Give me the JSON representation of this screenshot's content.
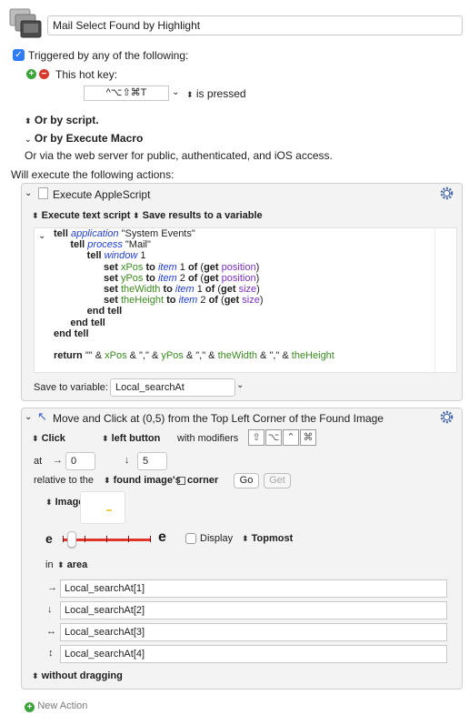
{
  "macro": {
    "name": "Mail Select Found by Highlight"
  },
  "triggers": {
    "heading": "Triggered by any of the following:",
    "hotkey_label": "This hot key:",
    "hotkey_value": "^⌥⇧⌘T",
    "hotkey_state": "is pressed",
    "or_script": "Or by script.",
    "or_execute_macro": "Or by Execute Macro",
    "web_server": "Or via the web server for public, authenticated, and iOS access."
  },
  "will_execute": "Will execute the following actions:",
  "action1": {
    "title": "Execute AppleScript",
    "mode": "Execute text script",
    "results_mode": "Save results to a variable",
    "code_lines": [
      [
        {
          "t": "tell ",
          "c": "kw"
        },
        {
          "t": "application",
          "c": "cls"
        },
        {
          "t": " \"System Events\"",
          "c": ""
        }
      ],
      [
        {
          "t": "      tell ",
          "c": "kw"
        },
        {
          "t": "process",
          "c": "cls"
        },
        {
          "t": " \"Mail\"",
          "c": ""
        }
      ],
      [
        {
          "t": "            tell ",
          "c": "kw"
        },
        {
          "t": "window",
          "c": "cls"
        },
        {
          "t": " 1",
          "c": ""
        }
      ],
      [
        {
          "t": "                  set ",
          "c": "kw"
        },
        {
          "t": "xPos",
          "c": "var"
        },
        {
          "t": " to ",
          "c": "kw"
        },
        {
          "t": "item",
          "c": "cls"
        },
        {
          "t": " 1 ",
          "c": ""
        },
        {
          "t": "of",
          "c": "kw"
        },
        {
          "t": " (",
          "c": ""
        },
        {
          "t": "get",
          "c": "kw"
        },
        {
          "t": " ",
          "c": ""
        },
        {
          "t": "position",
          "c": "prop"
        },
        {
          "t": ")",
          "c": ""
        }
      ],
      [
        {
          "t": "                  set ",
          "c": "kw"
        },
        {
          "t": "yPos",
          "c": "var"
        },
        {
          "t": " to ",
          "c": "kw"
        },
        {
          "t": "item",
          "c": "cls"
        },
        {
          "t": " 2 ",
          "c": ""
        },
        {
          "t": "of",
          "c": "kw"
        },
        {
          "t": " (",
          "c": ""
        },
        {
          "t": "get",
          "c": "kw"
        },
        {
          "t": " ",
          "c": ""
        },
        {
          "t": "position",
          "c": "prop"
        },
        {
          "t": ")",
          "c": ""
        }
      ],
      [
        {
          "t": "                  set ",
          "c": "kw"
        },
        {
          "t": "theWidth",
          "c": "var"
        },
        {
          "t": " to ",
          "c": "kw"
        },
        {
          "t": "item",
          "c": "cls"
        },
        {
          "t": " 1 ",
          "c": ""
        },
        {
          "t": "of",
          "c": "kw"
        },
        {
          "t": " (",
          "c": ""
        },
        {
          "t": "get",
          "c": "kw"
        },
        {
          "t": " ",
          "c": ""
        },
        {
          "t": "size",
          "c": "prop"
        },
        {
          "t": ")",
          "c": ""
        }
      ],
      [
        {
          "t": "                  set ",
          "c": "kw"
        },
        {
          "t": "theHeight",
          "c": "var"
        },
        {
          "t": " to ",
          "c": "kw"
        },
        {
          "t": "item",
          "c": "cls"
        },
        {
          "t": " 2 ",
          "c": ""
        },
        {
          "t": "of",
          "c": "kw"
        },
        {
          "t": " (",
          "c": ""
        },
        {
          "t": "get",
          "c": "kw"
        },
        {
          "t": " ",
          "c": ""
        },
        {
          "t": "size",
          "c": "prop"
        },
        {
          "t": ")",
          "c": ""
        }
      ],
      [
        {
          "t": "            end tell",
          "c": "kw"
        }
      ],
      [
        {
          "t": "      end tell",
          "c": "kw"
        }
      ],
      [
        {
          "t": "end tell",
          "c": "kw"
        }
      ],
      [
        {
          "t": "",
          "c": ""
        }
      ],
      [
        {
          "t": "return",
          "c": "kw"
        },
        {
          "t": " \"\" & ",
          "c": ""
        },
        {
          "t": "xPos",
          "c": "var"
        },
        {
          "t": " & \",\" & ",
          "c": ""
        },
        {
          "t": "yPos",
          "c": "var"
        },
        {
          "t": " & \",\" & ",
          "c": ""
        },
        {
          "t": "theWidth",
          "c": "var"
        },
        {
          "t": " & \",\" & ",
          "c": ""
        },
        {
          "t": "theHeight",
          "c": "var"
        }
      ]
    ],
    "save_label": "Save to variable:",
    "save_variable": "Local_searchAt"
  },
  "action2": {
    "title": "Move and Click at (0,5) from the Top Left Corner of the Found Image",
    "click_mode": "Click",
    "button": "left button",
    "modifiers_label": "with modifiers",
    "modifier_symbols": [
      "⇧",
      "⌥",
      "⌃",
      "⌘"
    ],
    "at_label": "at",
    "x_value": "0",
    "y_value": "5",
    "relative_label": "relative to the",
    "relative_option": "found image's",
    "corner_label": "corner",
    "go_button": "Go",
    "get_button": "Get",
    "image_label": "Image:",
    "display_label": "Display",
    "topmost_label": "Topmost",
    "in_label": "in",
    "area_option": "area",
    "area_fields": [
      "Local_searchAt[1]",
      "Local_searchAt[2]",
      "Local_searchAt[3]",
      "Local_searchAt[4]"
    ],
    "area_icons": [
      "→",
      "↓",
      "↔",
      "↕"
    ],
    "dragging_option": "without dragging"
  },
  "new_action": "New Action",
  "colors": {
    "accent_blue": "#2f7cf6",
    "slider_red": "#e0352b",
    "keyword_blue": "#1f3fd4",
    "variable_green": "#3a8a1e",
    "property_purple": "#7b2fbf"
  }
}
